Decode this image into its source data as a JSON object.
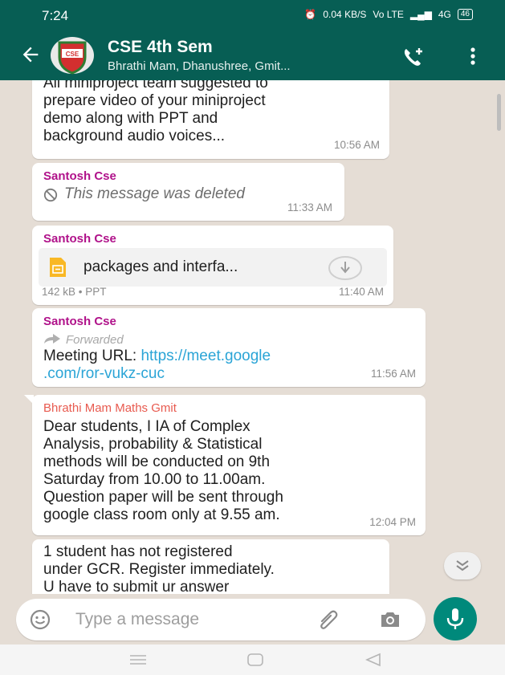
{
  "status_bar": {
    "time": "7:24",
    "speed": "0.04 KB/S",
    "network": "Vo LTE",
    "signal": "4G",
    "battery": "46"
  },
  "header": {
    "title": "CSE 4th Sem",
    "subtitle": "Bhrathi Mam, Dhanushree, Gmit...",
    "avatar_text": "CSE"
  },
  "messages": [
    {
      "lines": [
        "All miniproject team suggested to",
        "prepare video of your miniproject",
        "demo along with PPT and",
        "background audio voices..."
      ],
      "time": "10:56 AM"
    },
    {
      "sender": "Santosh Cse",
      "deleted_text": "This message was deleted",
      "time": "11:33 AM"
    },
    {
      "sender": "Santosh Cse",
      "file_name": "packages and interfa...",
      "file_meta": "142 kB • PPT",
      "time": "11:40 AM"
    },
    {
      "sender": "Santosh Cse",
      "forwarded": "Forwarded",
      "text_prefix": "Meeting URL: ",
      "link_line1": "https://meet.google",
      "link_line2": ".com/ror-vukz-cuc",
      "time": "11:56 AM"
    },
    {
      "sender": "Bhrathi Mam Maths Gmit",
      "lines": [
        "Dear students,  I IA of Complex",
        "Analysis, probability & Statistical",
        "methods will be conducted on 9th",
        "Saturday from 10.00 to 11.00am.",
        "Question paper will be sent through",
        "google class room only at 9.55 am."
      ],
      "time": "12:04 PM"
    },
    {
      "lines": [
        "1 student has not registered",
        "under GCR. Register immediately.",
        "U have to submit ur answer"
      ]
    }
  ],
  "input": {
    "placeholder": "Type a message"
  },
  "colors": {
    "header": "#075e54",
    "accent": "#00897b",
    "sender": "#b0128a",
    "sender_alt": "#e85a4f",
    "link": "#2aa4d6"
  }
}
